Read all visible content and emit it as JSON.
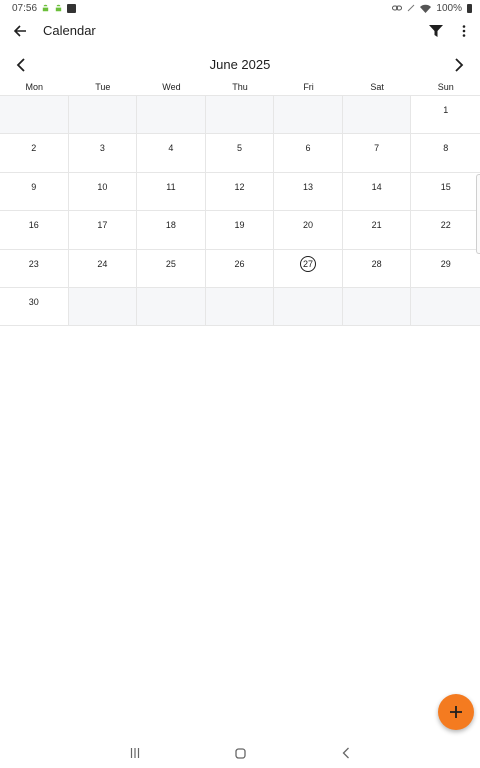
{
  "status_bar": {
    "time": "07:56",
    "battery": "100%",
    "icons": [
      "android-icon",
      "android-icon",
      "notification-square-icon",
      "link-icon",
      "no-signal-icon",
      "wifi-icon",
      "battery-icon"
    ]
  },
  "app_bar": {
    "title": "Calendar",
    "icons": [
      "back-arrow-icon",
      "filter-icon",
      "more-vert-icon"
    ]
  },
  "calendar": {
    "month_label": "June 2025",
    "weekdays": [
      "Mon",
      "Tue",
      "Wed",
      "Thu",
      "Fri",
      "Sat",
      "Sun"
    ],
    "days": [
      {
        "num": ""
      },
      {
        "num": ""
      },
      {
        "num": ""
      },
      {
        "num": ""
      },
      {
        "num": ""
      },
      {
        "num": ""
      },
      {
        "num": "1"
      },
      {
        "num": "2"
      },
      {
        "num": "3"
      },
      {
        "num": "4"
      },
      {
        "num": "5"
      },
      {
        "num": "6"
      },
      {
        "num": "7"
      },
      {
        "num": "8"
      },
      {
        "num": "9"
      },
      {
        "num": "10"
      },
      {
        "num": "11"
      },
      {
        "num": "12"
      },
      {
        "num": "13"
      },
      {
        "num": "14"
      },
      {
        "num": "15"
      },
      {
        "num": "16"
      },
      {
        "num": "17"
      },
      {
        "num": "18"
      },
      {
        "num": "19"
      },
      {
        "num": "20"
      },
      {
        "num": "21"
      },
      {
        "num": "22"
      },
      {
        "num": "23"
      },
      {
        "num": "24"
      },
      {
        "num": "25"
      },
      {
        "num": "26"
      },
      {
        "num": "27",
        "today": true
      },
      {
        "num": "28"
      },
      {
        "num": "29"
      },
      {
        "num": "30"
      },
      {
        "num": ""
      },
      {
        "num": ""
      },
      {
        "num": ""
      },
      {
        "num": ""
      },
      {
        "num": ""
      },
      {
        "num": ""
      }
    ]
  },
  "fab": {
    "icon": "plus-icon",
    "color": "#f47b20"
  },
  "nav_bar": {
    "icons": [
      "recent-apps-icon",
      "home-icon",
      "back-icon"
    ]
  }
}
